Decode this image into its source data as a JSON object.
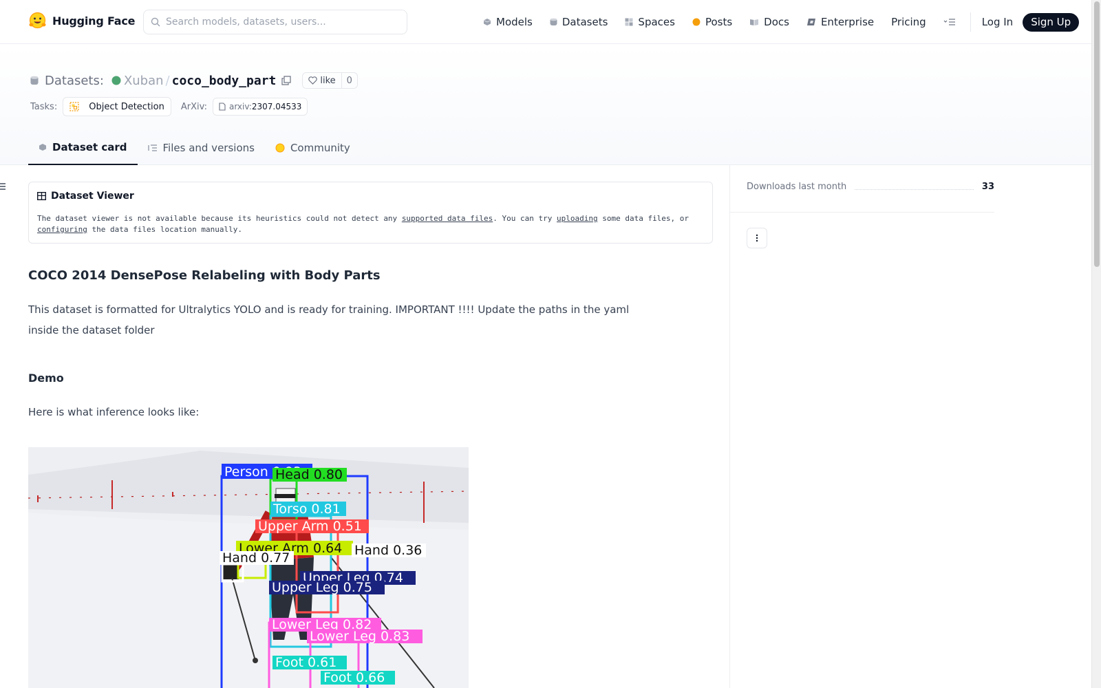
{
  "nav": {
    "brand": "Hugging Face",
    "search_placeholder": "Search models, datasets, users...",
    "links": [
      "Models",
      "Datasets",
      "Spaces",
      "Posts",
      "Docs",
      "Enterprise",
      "Pricing"
    ],
    "login": "Log In",
    "signup": "Sign Up"
  },
  "header": {
    "prefix": "Datasets:",
    "user": "Xuban",
    "slash": "/",
    "repo": "coco_body_part",
    "like_label": "like",
    "like_count": "0",
    "tasks_label": "Tasks:",
    "task": "Object Detection",
    "arxiv_label": "ArXiv:",
    "arxiv_prefix": "arxiv:",
    "arxiv_id": "2307.04533"
  },
  "tabs": [
    "Dataset card",
    "Files and versions",
    "Community"
  ],
  "viewer": {
    "title": "Dataset Viewer",
    "text_1": "The dataset viewer is not available because its heuristics could not detect any ",
    "link_1": "supported data files",
    "text_2": ". You can try ",
    "link_2": "uploading",
    "text_3": " some data files, or ",
    "link_3": "configuring",
    "text_4": " the data files location manually."
  },
  "card": {
    "heading": "COCO 2014 DensePose Relabeling with Body Parts",
    "paragraph": "This dataset is formatted for Ultralytics YOLO and is ready for training. IMPORTANT !!!! Update the paths in the yaml inside the dataset folder",
    "demo_heading": "Demo",
    "demo_text": "Here is what inference looks like:",
    "detections": [
      {
        "label": "Person 0.93",
        "color": "#1f3bff"
      },
      {
        "label": "Head 0.80",
        "color": "#22dd22"
      },
      {
        "label": "Torso 0.81",
        "color": "#22c8e0"
      },
      {
        "label": "Upper Arm 0.51",
        "color": "#ff4b4b"
      },
      {
        "label": "Lower Arm 0.64",
        "color": "#c8ec00"
      },
      {
        "label": "Hand 0.36",
        "color": "#ffffff"
      },
      {
        "label": "Hand 0.77",
        "color": "#ffffff"
      },
      {
        "label": "Upper Leg 0.74",
        "color": "#1a237e"
      },
      {
        "label": "Upper Leg 0.75",
        "color": "#1a237e"
      },
      {
        "label": "Lower Leg 0.82",
        "color": "#ff5ce0"
      },
      {
        "label": "Lower Leg 0.83",
        "color": "#ff5ce0"
      },
      {
        "label": "Foot 0.61",
        "color": "#13d6c4"
      },
      {
        "label": "Foot 0.66",
        "color": "#13d6c4"
      }
    ]
  },
  "sidebar": {
    "downloads_label": "Downloads last month",
    "downloads_value": "33"
  }
}
